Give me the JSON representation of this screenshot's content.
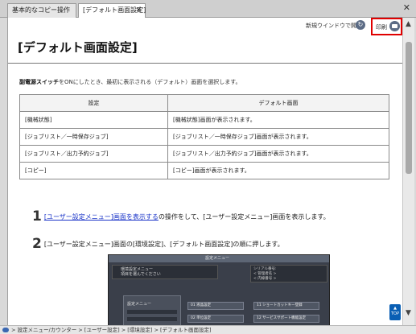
{
  "tabs": [
    {
      "label": "基本的なコピー操作",
      "active": false
    },
    {
      "label": "[デフォルト画面設定]",
      "active": true
    }
  ],
  "toolbar": {
    "new_window_label": "新規ウインドウで開く",
    "print_label": "印刷",
    "highlight_color": "#e00000"
  },
  "page": {
    "title": "[デフォルト画面設定]",
    "intro_bold": "副電源スイッチ",
    "intro_rest": "をONにしたとき、最初に表示される（デフォルト）画面を選択します。"
  },
  "table": {
    "headers": [
      "設定",
      "デフォルト画面"
    ],
    "rows": [
      [
        "[機械状態]",
        "[機械状態]画面が表示されます。"
      ],
      [
        "[ジョブリスト／一時保存ジョブ]",
        "[ジョブリスト／一時保存ジョブ]画面が表示されます。"
      ],
      [
        "[ジョブリスト／出力予約ジョブ]",
        "[ジョブリスト／出力予約ジョブ]画面が表示されます。"
      ],
      [
        "[コピー]",
        "[コピー]画面が表示されます。"
      ]
    ]
  },
  "steps": [
    {
      "num": "1",
      "link": "[ユーザー設定メニュー]画面を表示する",
      "text": "の操作をして、[ユーザー設定メニュー]画面を表示します。"
    },
    {
      "num": "2",
      "text": "[ユーザー設定メニュー]画面の[環境設定]、[デフォルト画面設定]の順に押します。"
    }
  ],
  "screenshot": {
    "title_bar": "設定メニュー",
    "message_line1": "環境設定メニュー",
    "message_line2": "項目を選んでください",
    "info_line1": "シリアル番号:",
    "info_line2": "< 管理者名 >",
    "info_line3": "< 内線番号 >",
    "menu_label": "設定メニュー",
    "buttons": [
      "01 液晶設定",
      "02 単位設定",
      "11 ショートカットキー登録",
      "12 サービスサポート機能設定"
    ]
  },
  "scroll_top_label": "TOP",
  "statusbar": {
    "breadcrumb": "> 設定メニュー/カウンター > [ユーザー設定] > [環境設定] > [デフォルト画面設定]"
  }
}
